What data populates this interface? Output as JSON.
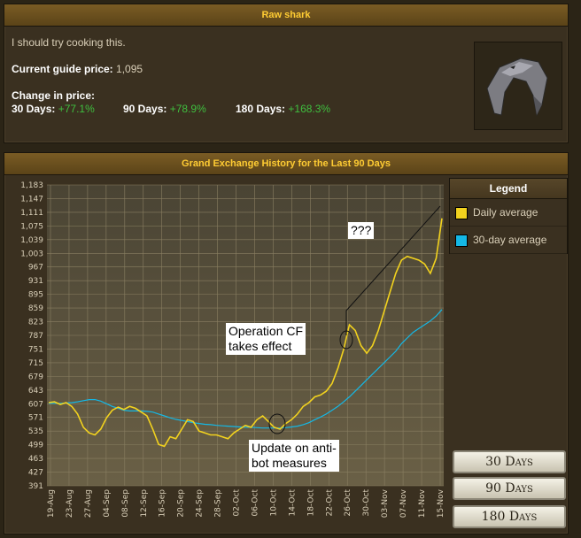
{
  "item": {
    "name": "Raw shark",
    "examine": "I should try cooking this.",
    "guide_price_label": "Current guide price:",
    "guide_price_value": "1,095",
    "change_label": "Change in price:",
    "change_30_label": "30 Days:",
    "change_30_value": "+77.1%",
    "change_90_label": "90 Days:",
    "change_90_value": "+78.9%",
    "change_180_label": "180 Days:",
    "change_180_value": "+168.3%"
  },
  "history": {
    "title": "Grand Exchange History for the Last 90 Days"
  },
  "legend": {
    "title": "Legend",
    "items": [
      {
        "label": "Daily average",
        "color": "#f2d21e"
      },
      {
        "label": "30-day average",
        "color": "#14b8e6"
      }
    ]
  },
  "range_buttons": {
    "d30": "30 Days",
    "d90": "90 Days",
    "d180": "180 Days"
  },
  "annotations": {
    "q": "???",
    "op_line1": "Operation CF",
    "op_line2": "takes effect",
    "upd_line1": "Update on anti-",
    "upd_line2": "bot measures"
  },
  "colors": {
    "daily": "#f2d21e",
    "avg30": "#14b8e6",
    "positive": "#3fbf3f",
    "header_text": "#ffcc33"
  },
  "chart_data": {
    "type": "line",
    "ylim": [
      391,
      1183
    ],
    "yticks": [
      391,
      427,
      463,
      499,
      535,
      571,
      607,
      643,
      679,
      715,
      751,
      787,
      823,
      859,
      895,
      931,
      967,
      1003,
      1039,
      1075,
      1111,
      1147,
      1183
    ],
    "xticks": [
      "19-Aug",
      "23-Aug",
      "27-Aug",
      "04-Sep",
      "08-Sep",
      "12-Sep",
      "16-Sep",
      "20-Sep",
      "24-Sep",
      "28-Sep",
      "02-Oct",
      "06-Oct",
      "10-Oct",
      "14-Oct",
      "18-Oct",
      "22-Oct",
      "26-Oct",
      "30-Oct",
      "03-Nov",
      "07-Nov",
      "11-Nov",
      "15-Nov"
    ],
    "series": [
      {
        "name": "Daily average",
        "values": [
          610,
          612,
          605,
          610,
          600,
          580,
          545,
          530,
          525,
          540,
          570,
          590,
          598,
          592,
          600,
          595,
          585,
          575,
          540,
          500,
          495,
          520,
          515,
          540,
          565,
          560,
          535,
          530,
          525,
          525,
          520,
          515,
          530,
          540,
          550,
          545,
          565,
          575,
          560,
          545,
          540,
          555,
          565,
          580,
          600,
          610,
          625,
          630,
          640,
          660,
          700,
          750,
          815,
          800,
          760,
          740,
          760,
          800,
          850,
          900,
          950,
          985,
          995,
          990,
          985,
          975,
          950,
          990,
          1095
        ]
      },
      {
        "name": "30-day average",
        "values": [
          608,
          608,
          608,
          609,
          610,
          612,
          615,
          618,
          618,
          614,
          607,
          600,
          595,
          590,
          588,
          588,
          588,
          587,
          585,
          580,
          575,
          570,
          566,
          563,
          560,
          557,
          555,
          553,
          552,
          550,
          549,
          548,
          547,
          546,
          545,
          545,
          544,
          543,
          543,
          543,
          543,
          544,
          546,
          548,
          552,
          557,
          565,
          572,
          580,
          590,
          600,
          612,
          625,
          640,
          655,
          670,
          685,
          700,
          715,
          730,
          745,
          765,
          780,
          795,
          805,
          815,
          825,
          838,
          855
        ]
      }
    ]
  }
}
